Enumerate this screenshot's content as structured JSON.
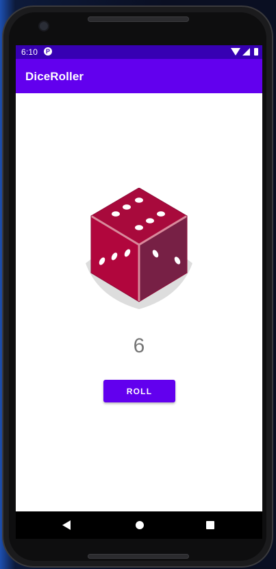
{
  "status_bar": {
    "time": "6:10"
  },
  "app_bar": {
    "title": "DiceRoller"
  },
  "main": {
    "result": "6",
    "roll_button_label": "ROLL"
  },
  "colors": {
    "status_bar": "#3700b3",
    "app_bar": "#6200ee",
    "button": "#6200ee",
    "dice_face": "#b1063d",
    "result_text": "#757575"
  },
  "icons": {
    "status_left": "p-app-icon",
    "status_right": [
      "wifi-icon",
      "signal-icon",
      "battery-icon"
    ],
    "navigation": [
      "back-icon",
      "home-icon",
      "recents-icon"
    ]
  }
}
